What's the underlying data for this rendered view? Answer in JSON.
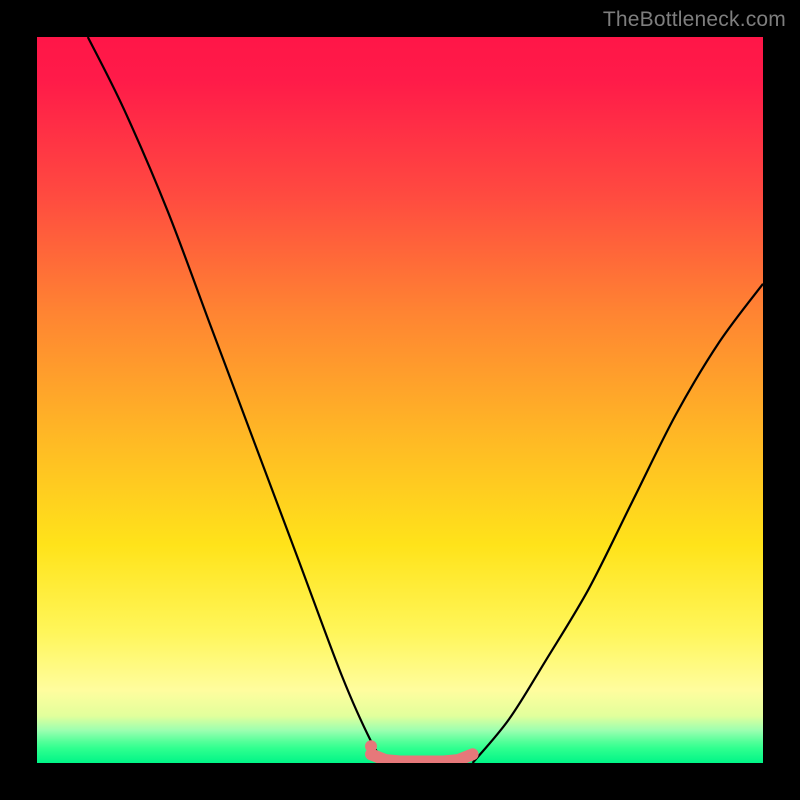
{
  "watermark": "TheBottleneck.com",
  "chart_data": {
    "type": "line",
    "title": "",
    "xlabel": "",
    "ylabel": "",
    "xlim": [
      0,
      100
    ],
    "ylim": [
      0,
      100
    ],
    "series": [
      {
        "name": "left-curve",
        "x": [
          7,
          12,
          18,
          24,
          30,
          36,
          42,
          46,
          48
        ],
        "values": [
          100,
          90,
          76,
          60,
          44,
          28,
          12,
          3,
          0
        ]
      },
      {
        "name": "right-curve",
        "x": [
          60,
          65,
          70,
          76,
          82,
          88,
          94,
          100
        ],
        "values": [
          0,
          6,
          14,
          24,
          36,
          48,
          58,
          66
        ]
      },
      {
        "name": "floor-pink-segment",
        "x": [
          46,
          48,
          50,
          52,
          54,
          56,
          58,
          60
        ],
        "values": [
          1.2,
          0.4,
          0.2,
          0.2,
          0.2,
          0.2,
          0.4,
          1.2
        ]
      }
    ],
    "colors": {
      "curve": "#000000",
      "floor_segment": "#e6787a",
      "floor_dot": "#e6787a"
    }
  }
}
